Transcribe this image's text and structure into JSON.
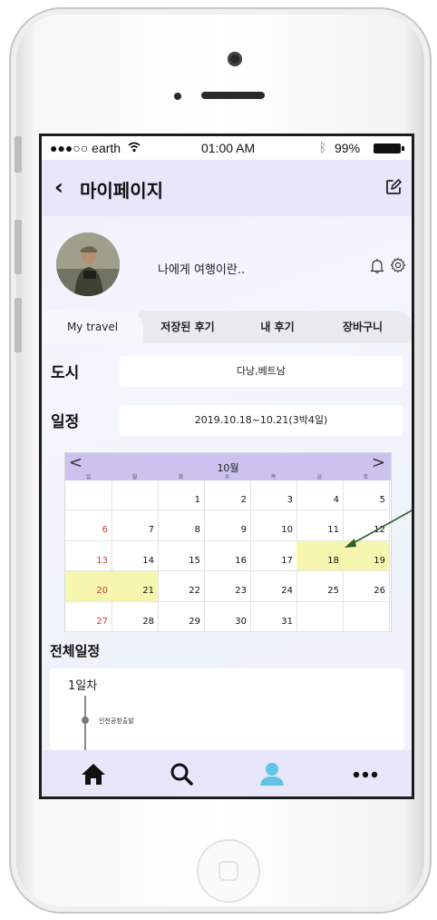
{
  "status_bar": {
    "carrier": "●●●○○ earth",
    "wifi_icon": "wifi-icon",
    "time": "01:00 AM",
    "bluetooth_icon": "bluetooth-icon",
    "battery": "99%"
  },
  "header": {
    "back": "‹",
    "title": "마이페이지",
    "edit_icon": "edit-icon"
  },
  "profile": {
    "bio": "나에게 여행이란..",
    "bell_icon": "bell-icon",
    "settings_icon": "gear-icon"
  },
  "tabs": [
    {
      "label": "My travel",
      "active": true
    },
    {
      "label": "저장된 후기",
      "active": false
    },
    {
      "label": "내 후기",
      "active": false
    },
    {
      "label": "장바구니",
      "active": false
    }
  ],
  "city": {
    "label": "도시",
    "value": "다낭,베트남"
  },
  "schedule": {
    "label": "일정",
    "value": "2019.10.18~10.21(3박4일)"
  },
  "calendar": {
    "prev": "<",
    "month": "10월",
    "next": ">",
    "weekdays": [
      "일",
      "월",
      "화",
      "수",
      "목",
      "금",
      "토"
    ],
    "weeks": [
      [
        "",
        "",
        "1",
        "2",
        "3",
        "4",
        "5"
      ],
      [
        "6",
        "7",
        "8",
        "9",
        "10",
        "11",
        "12"
      ],
      [
        "13",
        "14",
        "15",
        "16",
        "17",
        "18",
        "19"
      ],
      [
        "20",
        "21",
        "22",
        "23",
        "24",
        "25",
        "26"
      ],
      [
        "27",
        "28",
        "29",
        "30",
        "31",
        "",
        ""
      ]
    ],
    "highlighted": [
      "18",
      "19",
      "20",
      "21"
    ],
    "accent_color": "#cbc2ef",
    "highlight_color": "#f7f6ae"
  },
  "itinerary": {
    "title": "전체일정",
    "day": "1일차",
    "first_stop": "인천공항출발"
  },
  "tabbar": [
    {
      "icon": "home-icon",
      "active": false
    },
    {
      "icon": "search-icon",
      "active": false
    },
    {
      "icon": "user-icon",
      "active": true
    },
    {
      "icon": "more-icon",
      "active": false
    }
  ],
  "colors": {
    "header_bg": "#e8e6fb",
    "active_tab_icon": "#5fc4e6",
    "arrow": "#2d5e2e"
  }
}
